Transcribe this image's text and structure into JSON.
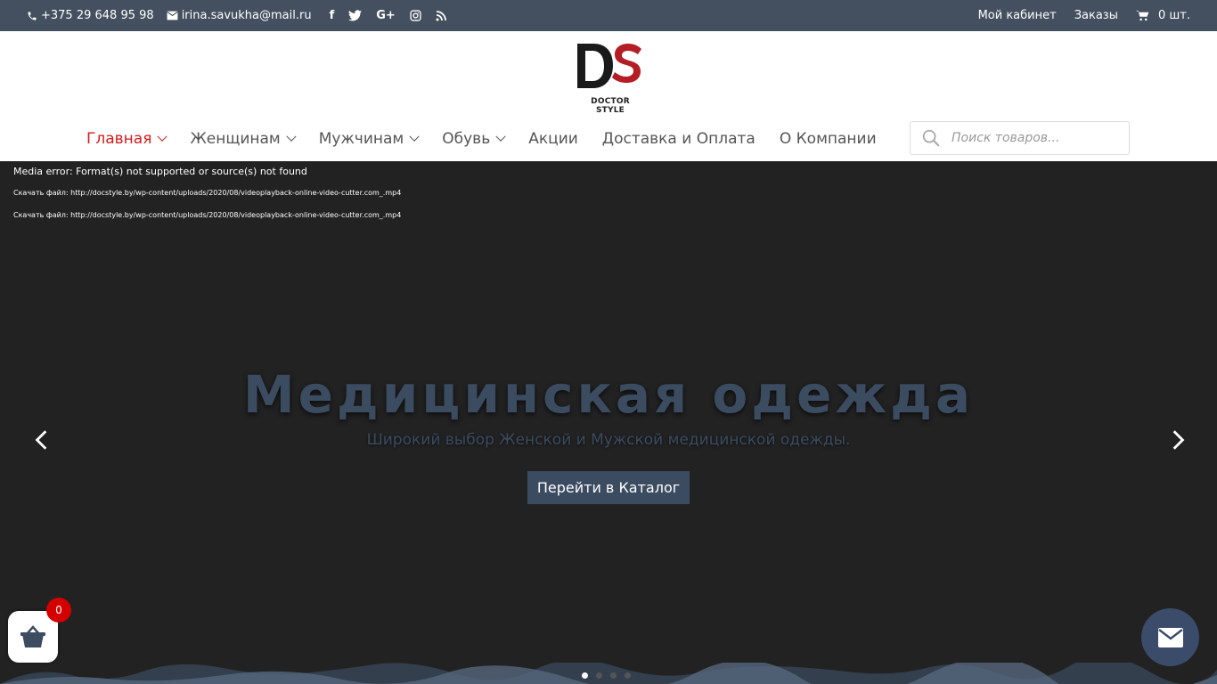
{
  "topbar": {
    "phone": "+375 29 648 95 98",
    "email": "irina.savukha@mail.ru",
    "social_icons": [
      "facebook-icon",
      "twitter-icon",
      "google-plus-icon",
      "instagram-icon",
      "rss-icon"
    ],
    "my_account": "Мой кабинет",
    "orders": "Заказы",
    "cart": "0 шт."
  },
  "header": {
    "logo_caption": "DOCTOR STYLE",
    "nav": [
      {
        "label": "Главная",
        "dropdown": true,
        "active": true
      },
      {
        "label": "Женщинам",
        "dropdown": true
      },
      {
        "label": "Мужчинам",
        "dropdown": true
      },
      {
        "label": "Обувь",
        "dropdown": true
      },
      {
        "label": "Акции",
        "dropdown": false
      },
      {
        "label": "Доставка и Оплата",
        "dropdown": false
      },
      {
        "label": "О Компании",
        "dropdown": false
      }
    ],
    "search_placeholder": "Поиск товаров..."
  },
  "hero": {
    "media_error": "Media error: Format(s) not supported or source(s) not found",
    "download_1": "Скачать файл: http://docstyle.by/wp-content/uploads/2020/08/videoplayback-online-video-cutter.com_.mp4",
    "download_2": "Скачать файл: http://docstyle.by/wp-content/uploads/2020/08/videoplayback-online-video-cutter.com_.mp4",
    "title": "Медицинская одежда",
    "subtitle": "Широкий выбор Женской и Мужской медицинской одежды.",
    "button": "Перейти в Каталог",
    "slide_count": 4,
    "active_slide": 1
  },
  "floating": {
    "cart_badge": "0"
  },
  "colors": {
    "topbar_bg": "#44505f",
    "accent_red": "#d61b1b",
    "hero_text": "#3b4b60",
    "hero_bg": "#222222"
  }
}
